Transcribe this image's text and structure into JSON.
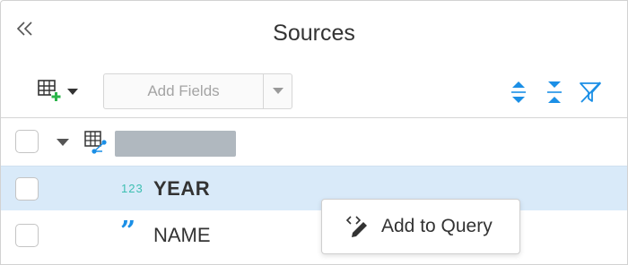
{
  "header": {
    "title": "Sources",
    "collapse_icon": "double-chevron-left-icon"
  },
  "toolbar": {
    "add_table_icon": "table-add-icon",
    "add_fields_label": "Add Fields",
    "expand_all_icon": "expand-all-icon",
    "collapse_all_icon": "collapse-all-icon",
    "filter_icon": "filter-off-icon"
  },
  "tree": {
    "source": {
      "icon": "data-source-icon",
      "name_redacted": true,
      "expanded": true
    },
    "fields": [
      {
        "type_label": "123",
        "type": "number",
        "name": "YEAR",
        "selected": true
      },
      {
        "type_label": "”",
        "type": "string",
        "name": "NAME",
        "selected": false
      }
    ]
  },
  "context_menu": {
    "icon": "code-pencil-icon",
    "label": "Add to Query"
  },
  "colors": {
    "accent_blue": "#1b8fe6",
    "number_type": "#3dbfb2",
    "selected_row": "#d9eaf9",
    "add_green": "#2bb44a"
  }
}
